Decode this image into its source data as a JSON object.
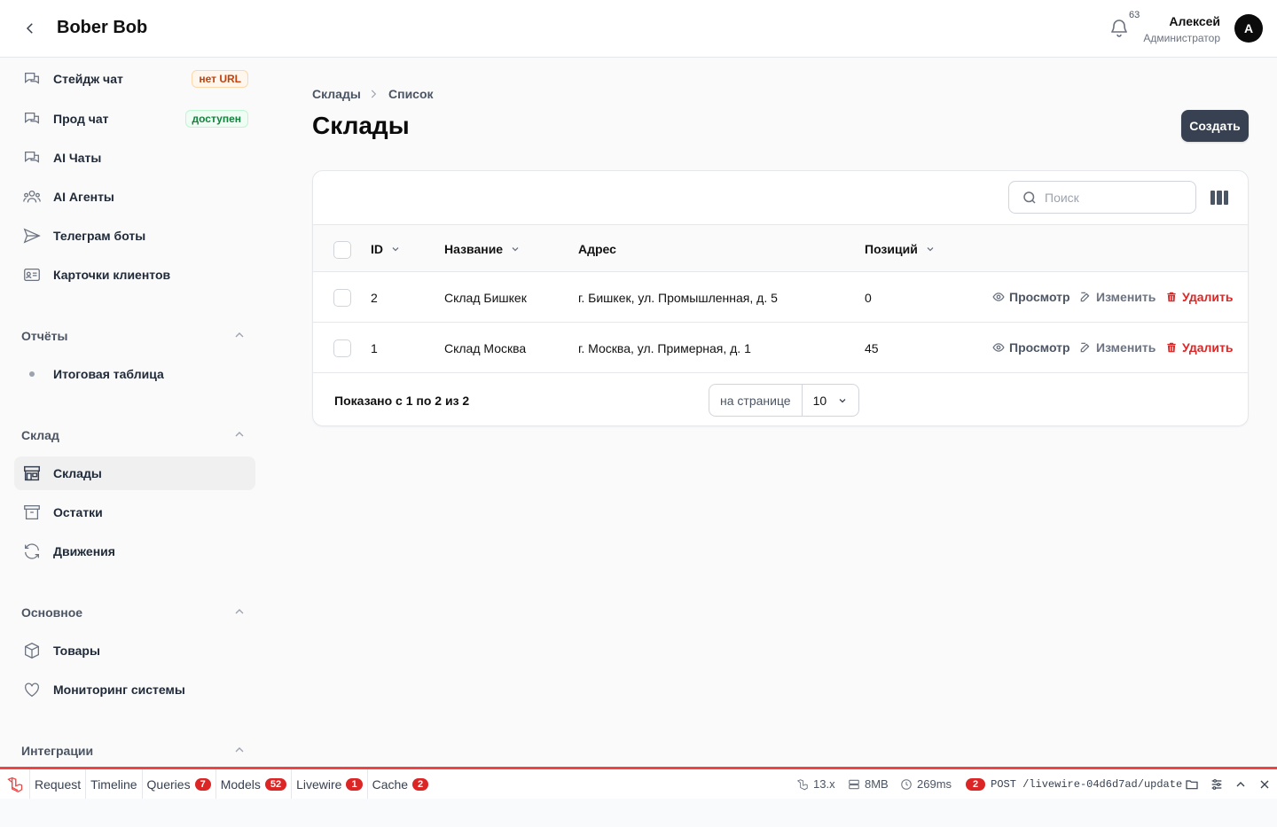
{
  "header": {
    "title": "Bober Bob",
    "notifications_count": "63",
    "user_name": "Алексей",
    "user_role": "Администратор",
    "avatar_letter": "A"
  },
  "sidebar": {
    "items": [
      {
        "label": "Стейдж чат",
        "badge": "нет URL",
        "icon": "chat-icon"
      },
      {
        "label": "Прод чат",
        "badge": "доступен",
        "icon": "chat-icon"
      },
      {
        "label": "AI Чаты",
        "icon": "chat-icon"
      },
      {
        "label": "AI Агенты",
        "icon": "users-icon"
      },
      {
        "label": "Телеграм боты",
        "icon": "send-icon"
      },
      {
        "label": "Карточки клиентов",
        "icon": "id-card-icon"
      }
    ],
    "groups": [
      {
        "label": "Отчёты",
        "items": [
          {
            "label": "Итоговая таблица",
            "icon": "dot-icon"
          }
        ]
      },
      {
        "label": "Склад",
        "items": [
          {
            "label": "Склады",
            "icon": "store-icon",
            "active": true
          },
          {
            "label": "Остатки",
            "icon": "archive-icon"
          },
          {
            "label": "Движения",
            "icon": "refresh-icon"
          }
        ]
      },
      {
        "label": "Основное",
        "items": [
          {
            "label": "Товары",
            "icon": "cube-icon"
          },
          {
            "label": "Мониторинг системы",
            "icon": "heart-icon"
          }
        ]
      },
      {
        "label": "Интеграции",
        "items": []
      }
    ]
  },
  "breadcrumb": {
    "items": [
      "Склады",
      "Список"
    ]
  },
  "page": {
    "title": "Склады",
    "create_label": "Создать"
  },
  "table": {
    "search_placeholder": "Поиск",
    "columns": [
      "ID",
      "Название",
      "Адрес",
      "Позиций"
    ],
    "rows": [
      {
        "id": "2",
        "name": "Склад Бишкек",
        "address": "г. Бишкек, ул. Промышленная, д. 5",
        "positions": "0"
      },
      {
        "id": "1",
        "name": "Склад Москва",
        "address": "г. Москва, ул. Примерная, д. 1",
        "positions": "45"
      }
    ],
    "actions": {
      "view": "Просмотр",
      "edit": "Изменить",
      "delete": "Удалить"
    },
    "footer": {
      "summary": "Показано с 1 по 2 из 2",
      "per_page_label": "на странице",
      "per_page_value": "10"
    }
  },
  "debugbar": {
    "tabs": [
      {
        "label": "Request"
      },
      {
        "label": "Timeline"
      },
      {
        "label": "Queries",
        "count": "7"
      },
      {
        "label": "Models",
        "count": "52"
      },
      {
        "label": "Livewire",
        "count": "1"
      },
      {
        "label": "Cache",
        "count": "2"
      }
    ],
    "laravel_version": "13.x",
    "memory": "8MB",
    "duration": "269ms",
    "requests_count": "2",
    "request": "POST /livewire-04d6d7ad/update",
    "accent_color": "#ef4444"
  }
}
